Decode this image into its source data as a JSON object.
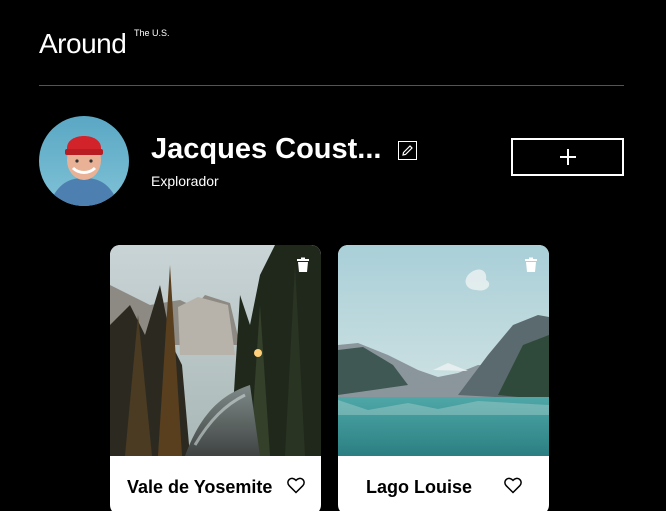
{
  "header": {
    "logo": "Around",
    "logo_superscript": "The U.S."
  },
  "profile": {
    "name": "Jacques Coust...",
    "role": "Explorador"
  },
  "cards": [
    {
      "title": "Vale de Yosemite"
    },
    {
      "title": "Lago Louise"
    }
  ]
}
